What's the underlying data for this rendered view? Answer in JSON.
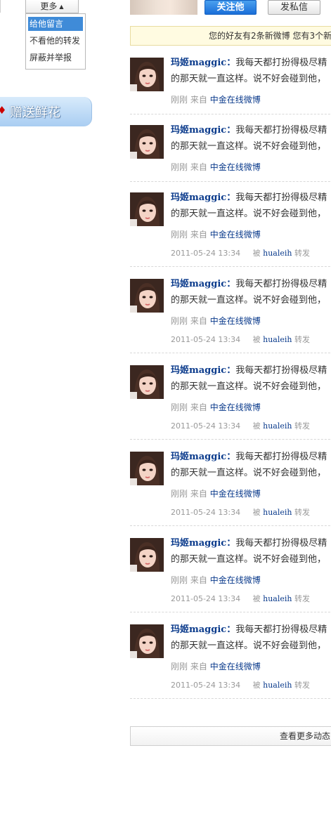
{
  "dropdown": {
    "toggle_label": "更多",
    "items": [
      {
        "label": "给他留言",
        "active": true
      },
      {
        "label": "不看他的转发",
        "active": false
      },
      {
        "label": "屏蔽并举报",
        "active": false
      }
    ]
  },
  "sidebar": {
    "gift_label": "赠送鲜花"
  },
  "header": {
    "follow_label": "关注他",
    "message_label": "发私信"
  },
  "notice": {
    "text": "您的好友有2条新微博  您有3个新"
  },
  "feed": [
    {
      "author": "玛姬maggic：",
      "text1": "我每天都打扮得极尽精",
      "text2": "的那天就一直这样。说不好会碰到他，",
      "time_ago": "刚刚",
      "from_label": "来自",
      "source": "中金在线微博",
      "fwd": null
    },
    {
      "author": "玛姬maggic：",
      "text1": "我每天都打扮得极尽精",
      "text2": "的那天就一直这样。说不好会碰到他，",
      "time_ago": "刚刚",
      "from_label": "来自",
      "source": "中金在线微博",
      "fwd": null
    },
    {
      "author": "玛姬maggic：",
      "text1": "我每天都打扮得极尽精",
      "text2": "的那天就一直这样。说不好会碰到他，",
      "time_ago": "刚刚",
      "from_label": "来自",
      "source": "中金在线微博",
      "fwd": {
        "date": "2011-05-24 13:34",
        "by": "被",
        "user": "hualeih",
        "action": "转发"
      }
    },
    {
      "author": "玛姬maggic：",
      "text1": "我每天都打扮得极尽精",
      "text2": "的那天就一直这样。说不好会碰到他，",
      "time_ago": "刚刚",
      "from_label": "来自",
      "source": "中金在线微博",
      "fwd": {
        "date": "2011-05-24 13:34",
        "by": "被",
        "user": "hualeih",
        "action": "转发"
      }
    },
    {
      "author": "玛姬maggic：",
      "text1": "我每天都打扮得极尽精",
      "text2": "的那天就一直这样。说不好会碰到他，",
      "time_ago": "刚刚",
      "from_label": "来自",
      "source": "中金在线微博",
      "fwd": {
        "date": "2011-05-24 13:34",
        "by": "被",
        "user": "hualeih",
        "action": "转发"
      }
    },
    {
      "author": "玛姬maggic：",
      "text1": "我每天都打扮得极尽精",
      "text2": "的那天就一直这样。说不好会碰到他，",
      "time_ago": "刚刚",
      "from_label": "来自",
      "source": "中金在线微博",
      "fwd": {
        "date": "2011-05-24 13:34",
        "by": "被",
        "user": "hualeih",
        "action": "转发"
      }
    },
    {
      "author": "玛姬maggic：",
      "text1": "我每天都打扮得极尽精",
      "text2": "的那天就一直这样。说不好会碰到他，",
      "time_ago": "刚刚",
      "from_label": "来自",
      "source": "中金在线微博",
      "fwd": {
        "date": "2011-05-24 13:34",
        "by": "被",
        "user": "hualeih",
        "action": "转发"
      }
    },
    {
      "author": "玛姬maggic：",
      "text1": "我每天都打扮得极尽精",
      "text2": "的那天就一直这样。说不好会碰到他，",
      "time_ago": "刚刚",
      "from_label": "来自",
      "source": "中金在线微博",
      "fwd": {
        "date": "2011-05-24 13:34",
        "by": "被",
        "user": "hualeih",
        "action": "转发"
      }
    }
  ],
  "load_more": {
    "label": "查看更多动态"
  }
}
